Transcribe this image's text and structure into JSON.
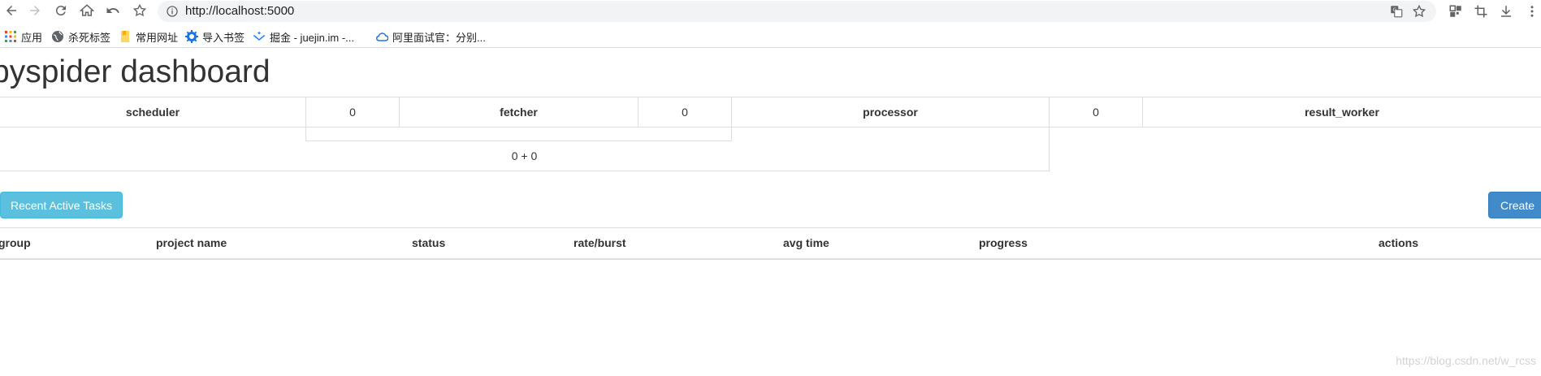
{
  "browser": {
    "url": "http://localhost:5000",
    "bookmarks": [
      {
        "label": "应用",
        "icon": "apps-grid-icon"
      },
      {
        "label": "杀死标签",
        "icon": "globe-icon"
      },
      {
        "label": "常用网址",
        "icon": "folder-icon"
      },
      {
        "label": "导入书签",
        "icon": "gear-icon"
      },
      {
        "label": "掘金 - juejin.im -...",
        "icon": "juejin-icon"
      },
      {
        "label": "阿里面试官：分别...",
        "icon": "cloud-icon"
      }
    ]
  },
  "page": {
    "title": "pyspider dashboard"
  },
  "queues": {
    "scheduler": "scheduler",
    "scheduler_fetcher_count": "0",
    "fetcher": "fetcher",
    "fetcher_processor_count": "0",
    "processor": "processor",
    "processor_result_count": "0",
    "result_worker": "result_worker",
    "fetcher_sum": "0 + 0"
  },
  "actions": {
    "recent_tasks_label": "Recent Active Tasks",
    "create_label": "Create"
  },
  "projects": {
    "headers": [
      "group",
      "project name",
      "status",
      "rate/burst",
      "avg time",
      "progress",
      "actions"
    ],
    "rows": []
  },
  "watermark": "https://blog.csdn.net/w_rcss",
  "colors": {
    "info_button": "#5bc0de",
    "primary_button": "#428bca",
    "border": "#dddddd"
  }
}
